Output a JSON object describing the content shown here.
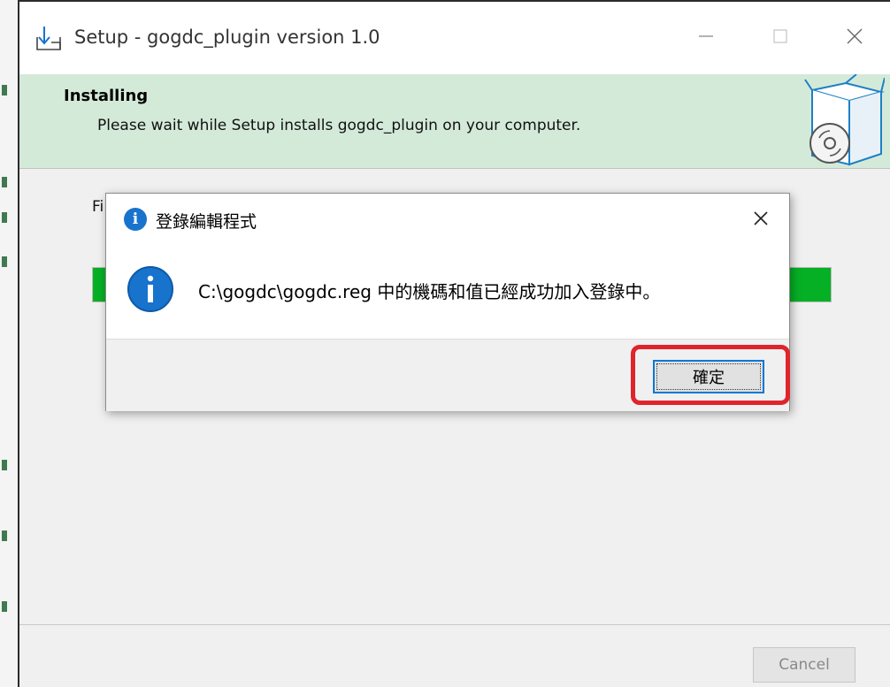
{
  "window": {
    "title": "Setup - gogdc_plugin version 1.0",
    "icons": {
      "app": "install-download-icon",
      "minimize": "minimize-icon",
      "maximize": "maximize-icon",
      "close": "close-icon"
    }
  },
  "header": {
    "title": "Installing",
    "subtitle": "Please wait while Setup installs gogdc_plugin on your computer.",
    "art": "software-box-cd-icon"
  },
  "status": {
    "text_fragment": "Fi"
  },
  "progress": {
    "value": 1.0,
    "color": "#06b025"
  },
  "footer": {
    "cancel_label": "Cancel"
  },
  "dialog": {
    "title": "登錄編輯程式",
    "message": "C:\\gogdc\\gogdc.reg 中的機碼和值已經成功加入登錄中。",
    "ok_label": "確定",
    "icons": {
      "title": "info-icon",
      "message": "info-icon",
      "close": "close-icon"
    }
  },
  "annotation": {
    "highlight_color": "#e0242c",
    "target": "ok-button"
  }
}
